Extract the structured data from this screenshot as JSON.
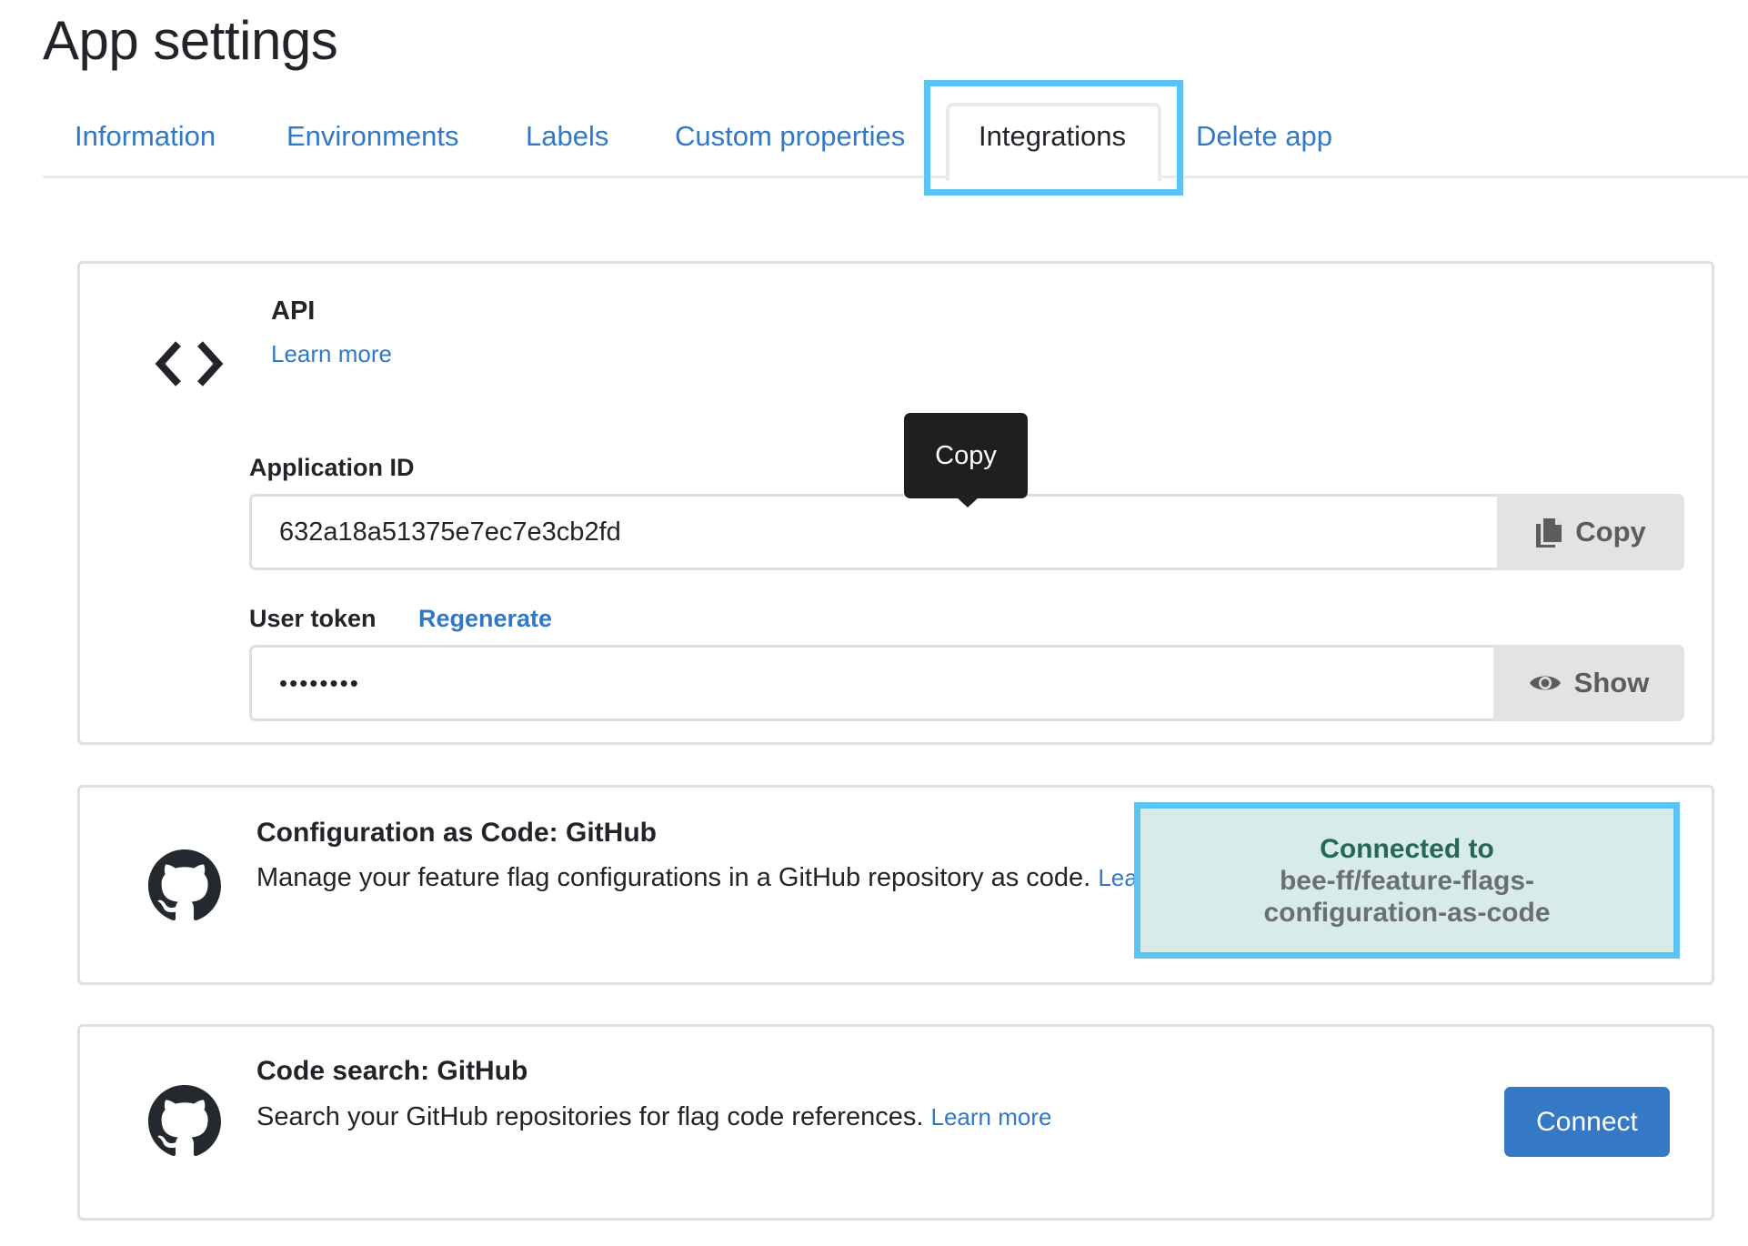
{
  "page": {
    "title": "App settings"
  },
  "tabs": [
    {
      "label": "Information",
      "active": false
    },
    {
      "label": "Environments",
      "active": false
    },
    {
      "label": "Labels",
      "active": false
    },
    {
      "label": "Custom properties",
      "active": false
    },
    {
      "label": "Integrations",
      "active": true
    },
    {
      "label": "Delete app",
      "active": false
    }
  ],
  "api": {
    "icon": "code-brackets-icon",
    "title": "API",
    "learn_more": "Learn more",
    "application_id": {
      "label": "Application ID",
      "value": "632a18a51375e7ec7e3cb2fd",
      "button_label": "Copy",
      "button_icon": "copy-icon"
    },
    "user_token": {
      "label": "User token",
      "regenerate_label": "Regenerate",
      "value_masked": "••••••••",
      "button_label": "Show",
      "button_icon": "eye-icon"
    },
    "tooltip": "Copy"
  },
  "integrations": [
    {
      "icon": "github-icon",
      "title": "Configuration as Code: GitHub",
      "description": "Manage your feature flag configurations in a GitHub repository as code.",
      "learn_more": "Learn more",
      "status": {
        "label": "Connected to",
        "repo": "bee-ff/feature-flags-configuration-as-code"
      }
    },
    {
      "icon": "github-icon",
      "title": "Code search: GitHub",
      "description": "Search your GitHub repositories for flag code references.",
      "learn_more": "Learn more",
      "button_label": "Connect"
    }
  ],
  "colors": {
    "link": "#3178c6",
    "highlight": "#5bc4f5",
    "connected_bg": "#d7ebe8",
    "connected_text": "#276756",
    "primary_button": "#3478c6"
  }
}
